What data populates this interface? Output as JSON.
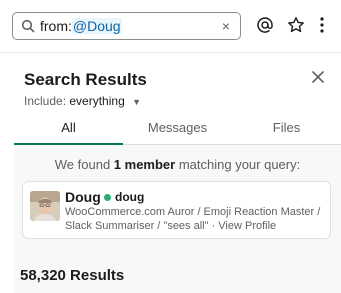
{
  "search": {
    "prefix": "from:",
    "mention": "@Doug",
    "clear_label": "×"
  },
  "toolbar": {
    "mention_icon": "at-icon",
    "star_icon": "star-icon",
    "more_icon": "more-vertical-icon"
  },
  "panel": {
    "title": "Search Results",
    "include_label": "Include:",
    "include_value": "everything",
    "tabs": [
      {
        "label": "All",
        "active": true
      },
      {
        "label": "Messages",
        "active": false
      },
      {
        "label": "Files",
        "active": false
      }
    ]
  },
  "members": {
    "found_prefix": "We found ",
    "found_count": "1 member",
    "found_suffix": " matching your query:",
    "card": {
      "name": "Doug",
      "handle": "doug",
      "bio": "WooCommerce.com Auror / Emoji Reaction Master / Slack Summariser / \"sees all\"",
      "separator": " · ",
      "view_profile": "View Profile"
    }
  },
  "results": {
    "count_label": "58,320 Results"
  },
  "colors": {
    "accent": "#007a5a",
    "presence": "#2bac76",
    "mention_bg": "#e8f5fa",
    "mention_fg": "#1264a3"
  }
}
